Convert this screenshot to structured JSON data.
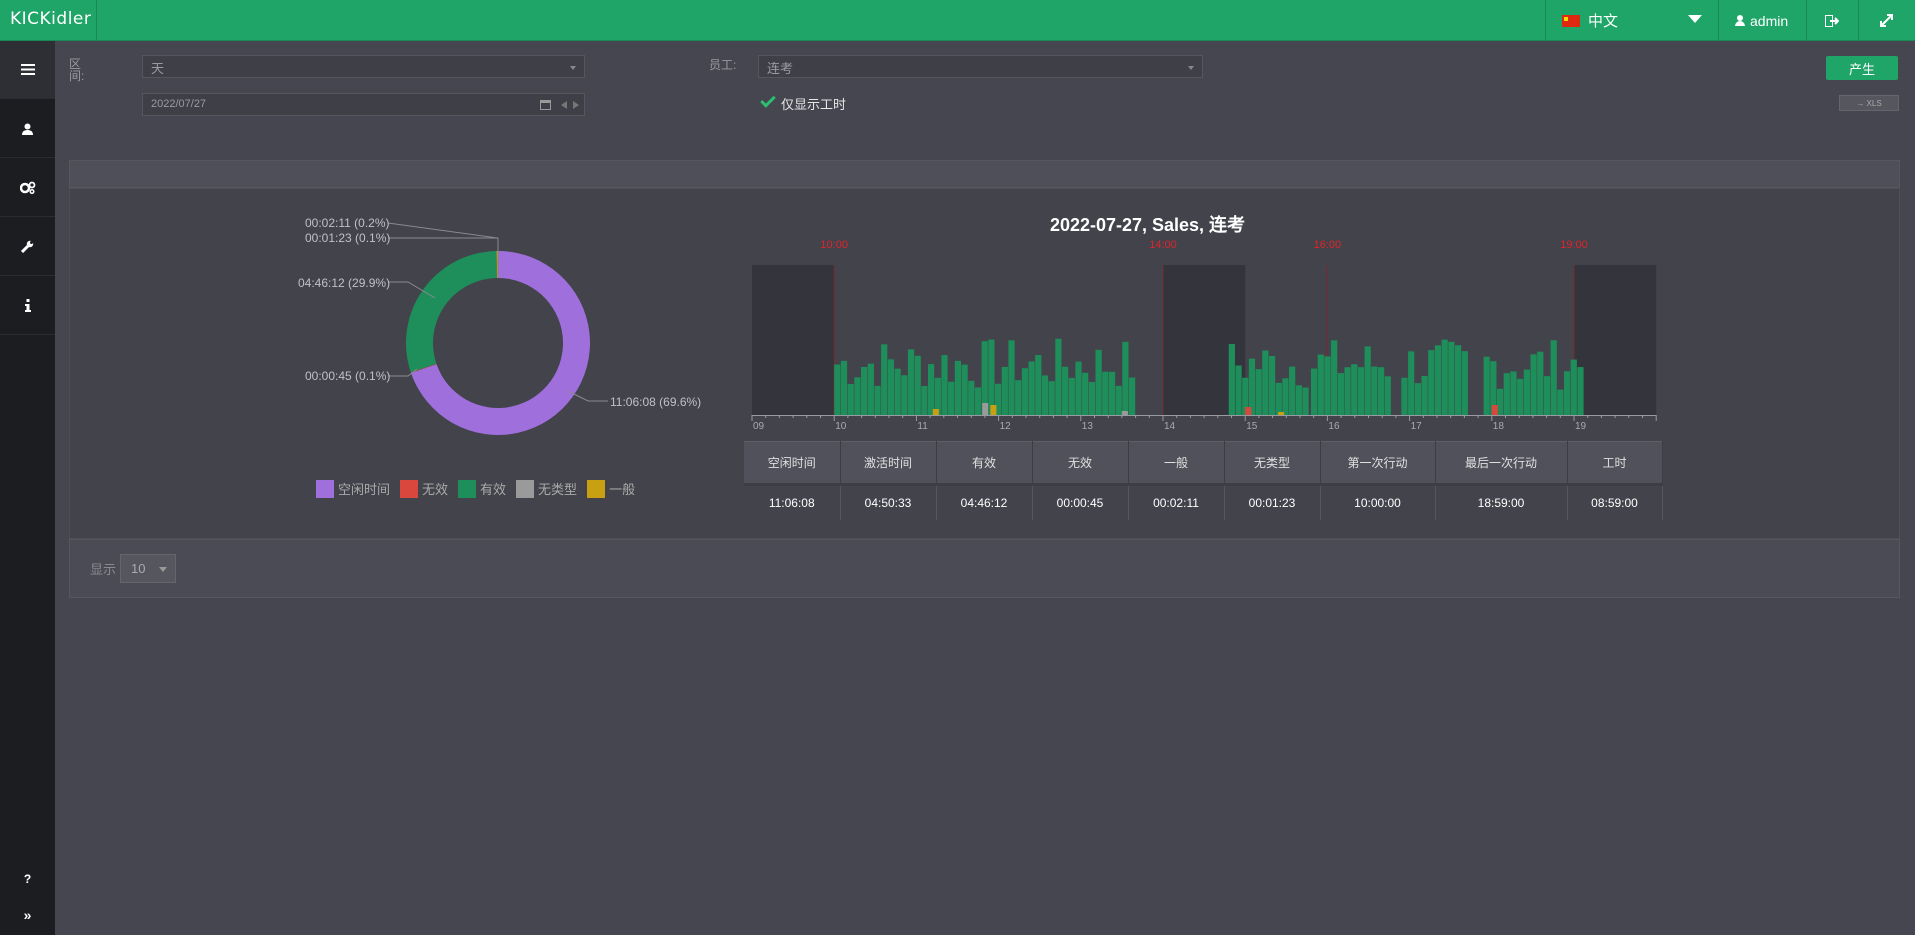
{
  "topbar": {
    "logo": "KICKidler",
    "language": "中文",
    "user": "admin"
  },
  "sidebar": {
    "items": [
      "list-icon",
      "user-icon",
      "gears-icon",
      "wrench-icon",
      "info-icon"
    ],
    "bottom": [
      "help-icon",
      "expand-icon"
    ]
  },
  "filters": {
    "period_label": "区间:",
    "period_value": "天",
    "employee_label": "员工:",
    "employee_value": "连考",
    "date_value": "2022/07/27",
    "only_work_hours_label": "仅显示工时",
    "only_work_hours_checked": true,
    "generate_button": "产生",
    "xls_button": "→ XLS"
  },
  "donut": {
    "labels": {
      "general": "00:02:11 (0.2%)",
      "untyped": "00:01:23 (0.1%)",
      "effective": "04:46:12 (29.9%)",
      "ineffective": "00:00:45 (0.1%)",
      "idle": "11:06:08 (69.6%)"
    },
    "slices": [
      {
        "name": "空闲时间",
        "value": 69.6,
        "color": "#9f6fdc"
      },
      {
        "name": "无效",
        "value": 0.1,
        "color": "#d9473d"
      },
      {
        "name": "有效",
        "value": 29.9,
        "color": "#1e8f5a"
      },
      {
        "name": "无类型",
        "value": 0.1,
        "color": "#9a9a9a"
      },
      {
        "name": "一般",
        "value": 0.2,
        "color": "#c9a012"
      }
    ],
    "legend": [
      "空闲时间",
      "无效",
      "有效",
      "无类型",
      "一般"
    ]
  },
  "timeline": {
    "title": "2022-07-27, Sales, 连考",
    "markers": [
      "10:00",
      "14:00",
      "16:00",
      "19:00"
    ],
    "hours": [
      "09",
      "10",
      "11",
      "12",
      "13",
      "14",
      "15",
      "16",
      "17",
      "18",
      "19"
    ]
  },
  "stats": {
    "headers": [
      "空闲时间",
      "激活时间",
      "有效",
      "无效",
      "一般",
      "无类型",
      "第一次行动",
      "最后一次行动",
      "工时"
    ],
    "values": [
      "11:06:08",
      "04:50:33",
      "04:46:12",
      "00:00:45",
      "00:02:11",
      "00:01:23",
      "10:00:00",
      "18:59:00",
      "08:59:00"
    ]
  },
  "pagination": {
    "show_label": "显示",
    "page_size": "10"
  },
  "colors": {
    "accent": "#1ea567",
    "idle": "#9f6fdc",
    "effective": "#1e8f5a",
    "ineffective": "#d9473d",
    "untyped": "#9a9a9a",
    "general": "#c9a012",
    "marker": "#e0242a"
  }
}
